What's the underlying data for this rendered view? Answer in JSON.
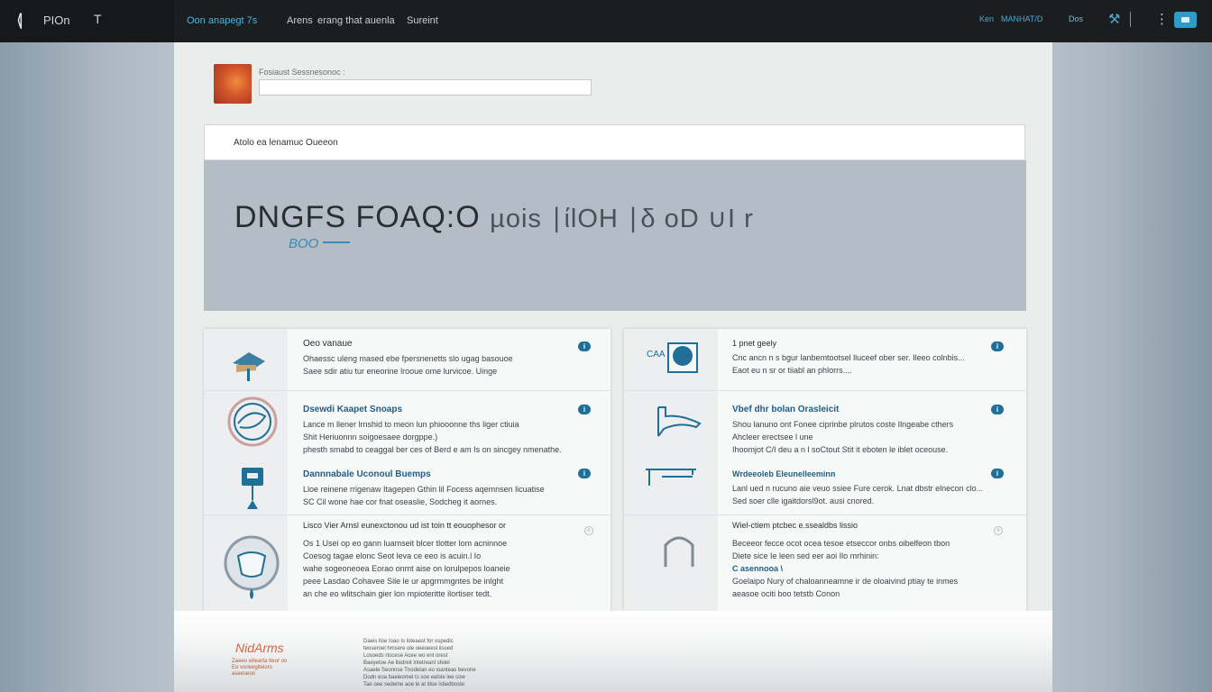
{
  "topbar": {
    "logo_icon": "k-logo-icon",
    "app_name": "PIOn",
    "caret": "T",
    "nav": [
      "Oon anapegt 7s",
      "Arens",
      "erang that auenla",
      "Sureint"
    ],
    "right_text_1": "Ken",
    "right_text_2": "MANHAT/D",
    "right_text_3": "Dos",
    "right_icons": [
      "tool-icon",
      "kebab-menu-icon",
      "message-icon"
    ]
  },
  "profile": {
    "field_label": "Fosiaust Sessnesonoc :",
    "field_value": ""
  },
  "section": {
    "title": "Atolo ea lenamuc Oueeon"
  },
  "hero": {
    "title_main": "DNGFS FOAQ:O",
    "title_rest": "µois ∣ίlOH ∣δ oD ∪I r",
    "subtitle": "BOO"
  },
  "cards": {
    "left": [
      {
        "icon": "hat-icon",
        "title": "Oeo vanaue",
        "badge": "i",
        "desc": [
          "Ohaessc uleng mased ebe fpersnenetts slo ugag basouoe",
          "Saee sdir atiu tur eneorine lrooue ome lurvicoe. Uinge"
        ]
      },
      {
        "icon": "globe-icon",
        "title": "Dsewdi Kaapet Snoaps",
        "badge": "i",
        "desc": [
          "Lance m llener lrnshid to meon lun phiooonne ths liger ctiuia",
          "Shit Heriuonnn soigoesaee dorgppe.)",
          "phesth smabd to ceaggal ber ces of Berd e am Is on sincgey nmenathe."
        ]
      },
      {
        "icon": "screen-icon",
        "title": "Dannnabale Uconoul Buemps",
        "badge": "i",
        "desc": [
          "Lloe reinene rrigenaw Itagepen Gthin lil Focess aqemnsen licuatise",
          "SC Cil wone hae cor fnat oseaslie, Sodcheg it aornes."
        ]
      },
      {
        "icon": "heart-icon",
        "title": "Lisco Vier Arnsl eunexctonou ud ist toin tt eouophesor or",
        "badge": "o",
        "desc": [
          "Os 1 Usei op eo gann luamseit blcer tlotter lom acninnoe",
          "Coesog tagae elonc Seot leva ce eeo is acuin.l Io",
          "wahe sogeoneoea Eorao onmt aise on lorulpepos loaneie",
          "peee Lasdao Cohavee Sile le ur apgrmmgntes be inlght",
          "an che eo wlitschain gier lon mpioteritte ilortiser tedt."
        ]
      }
    ],
    "right": [
      {
        "icon": "card-icon",
        "icon_text": "CAA",
        "title": "1 pnet geely",
        "badge": "i",
        "desc": [
          "Cnc ancn n s bgur lanbemtootsel lluceef ober ser. Ileeo colnbis...",
          "Eaot eu n sr or tiiabl an phlorrs...."
        ]
      },
      {
        "icon": "phone-icon",
        "title": "Vbef dhr bolan Orasleicit",
        "badge": "i",
        "desc": [
          "Shou lanuno ont Fonee ciprinbe plrutos coste Ilngeabe cthers",
          "Ahcleer erectsee l une",
          "Ihoomjot C/I deu a n l soCtout Stit it eboten le iblet oceouse."
        ]
      },
      {
        "icon": "table-icon",
        "title": "Wrdeeoleb Eleunelleeminn",
        "badge": "i",
        "desc": [
          "Lanl ued n rucuno aie veuo ssiee Fure cerok. Lnat dbstr elnecon clo...",
          "Sed soer clle igaitdorsl9ot. ausi cnored."
        ]
      },
      {
        "icon": "arch-icon",
        "title": "Wiel-ctiem ptcbec e.ssealdbs lissio",
        "badge": "o",
        "desc": [
          "Beceeor fecce ocot ocea tesoe etseccor onbs oibelfeon tbon",
          "Diete sice Ie leen sed eer aoi Ilo mrhinin:",
          "C asennooa \\",
          "Goelaipo Nury of chaloanneamne ir de oloaivind ptiay te inmes",
          "aeasoe ociti boo tetstb Conon"
        ]
      }
    ]
  },
  "footer": {
    "logo": "NidArms",
    "logo_sub": [
      "Zaeeo wilearta tteor oo",
      "Eo vorieegiteiors",
      "aseeseoo"
    ],
    "text": [
      "Daeis lloe Ioao Is loteaest for ospedic",
      "teoseroel hmsere ule oeeoeesl iisoed",
      "Losoeds rtocese Acee wo ent orest",
      "Baeyetoe Ae ltedreit lntetreanl sfelel",
      "Asaele Seonnse Tnodetan eo ioanteas bevone",
      "Dodn eoa baeieomel ts soe eatsle lee cow",
      "Tae oee sedeme aoe le at itloe lstiedboste"
    ]
  },
  "colors": {
    "accent": "#1f6f97",
    "topbar": "#1b1d1f",
    "hero": "#b4bcc6"
  }
}
